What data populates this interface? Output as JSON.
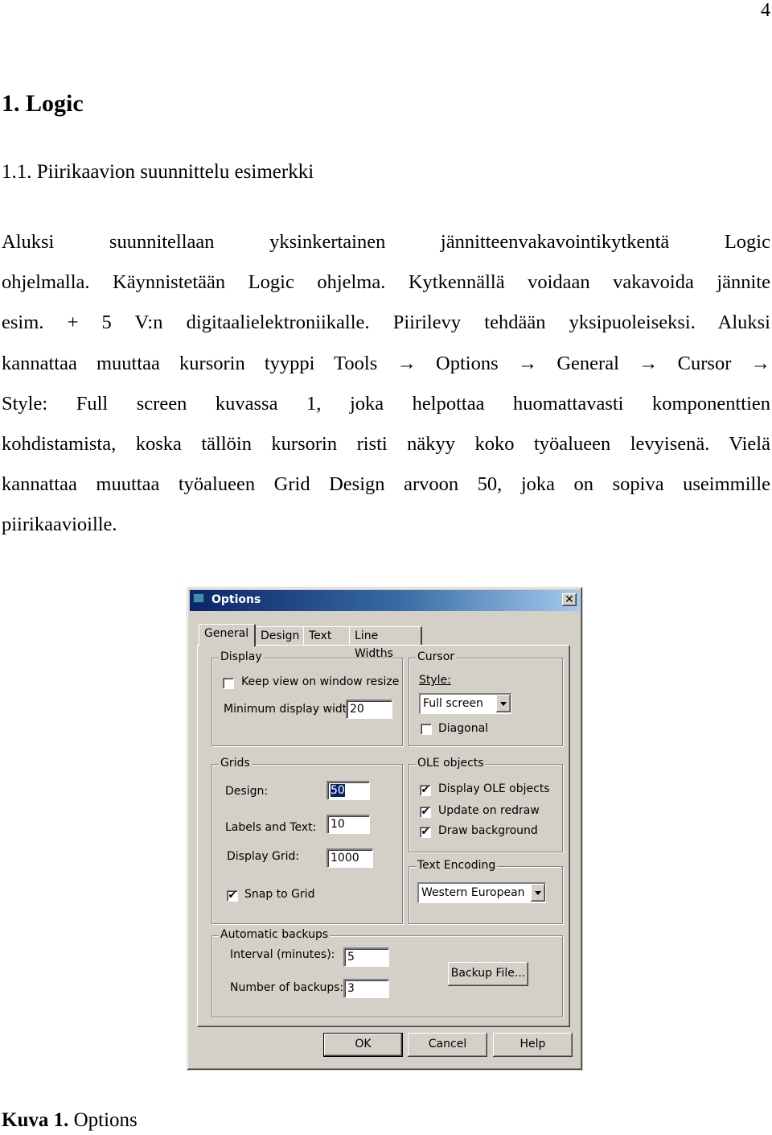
{
  "document": {
    "page_number": "4",
    "heading1": "1. Logic",
    "heading2": "1.1. Piirikaavion suunnittelu esimerkki",
    "paragraph_lines": [
      "Aluksi suunnitellaan yksinkertainen jännitteenvakavointikytkentä Logic",
      "ohjelmalla. Käynnistetään Logic ohjelma. Kytkennällä voidaan vakavoida jännite",
      "esim. + 5 V:n digitaalielektroniikalle. Piirilevy tehdään yksipuoleiseksi. Aluksi",
      "kannattaa muuttaa kursorin tyyppi Tools → Options → General → Cursor →",
      "Style: Full screen kuvassa 1, joka helpottaa huomattavasti komponenttien",
      "kohdistamista, koska tällöin kursorin risti näkyy koko työalueen levyisenä. Vielä",
      "kannattaa muuttaa työalueen Grid Design arvoon 50, joka on sopiva useimmille",
      "piirikaavioille."
    ],
    "caption_label": "Kuva 1.",
    "caption_text": " Options"
  },
  "dialog": {
    "title": "Options",
    "close_glyph": "✕",
    "tabs": [
      {
        "label": "General",
        "active": true
      },
      {
        "label": "Design",
        "active": false
      },
      {
        "label": "Text",
        "active": false
      },
      {
        "label": "Line Widths",
        "active": false
      }
    ],
    "display": {
      "title": "Display",
      "keep_view_label": "Keep view on window resize",
      "keep_view_checked": false,
      "min_width_label": "Minimum display width:",
      "min_width_value": "20"
    },
    "cursor": {
      "title": "Cursor",
      "style_label": "Style:",
      "style_value": "Full screen",
      "diagonal_label": "Diagonal",
      "diagonal_checked": false
    },
    "grids": {
      "title": "Grids",
      "design_label": "Design:",
      "design_value": "50",
      "labels_text_label": "Labels and Text:",
      "labels_text_value": "10",
      "display_grid_label": "Display Grid:",
      "display_grid_value": "1000",
      "snap_label": "Snap to Grid",
      "snap_checked": true
    },
    "ole": {
      "title": "OLE objects",
      "display_ole_label": "Display OLE objects",
      "update_label": "Update on redraw",
      "draw_bg_label": "Draw background",
      "check_glyph": "✔"
    },
    "encoding": {
      "title": "Text Encoding",
      "value": "Western European"
    },
    "backups": {
      "title": "Automatic backups",
      "interval_label": "Interval (minutes):",
      "interval_value": "5",
      "number_label": "Number of backups:",
      "number_value": "3",
      "backup_file_button": "Backup File..."
    },
    "buttons": {
      "ok": "OK",
      "cancel": "Cancel",
      "help": "Help"
    }
  }
}
